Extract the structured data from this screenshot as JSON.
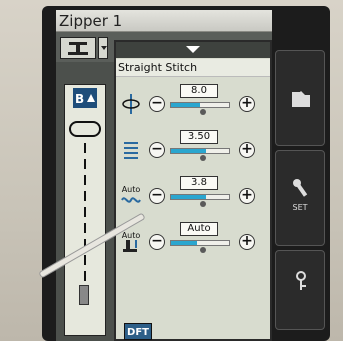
{
  "window": {
    "title": "Zipper 1"
  },
  "panel": {
    "stitch_name": "Straight Stitch",
    "default_button": "DFT"
  },
  "settings": [
    {
      "icon": "stitch-width-icon",
      "value": "8.0",
      "fill": 0.5,
      "knob": 0.55
    },
    {
      "icon": "stitch-length-icon",
      "value": "3.50",
      "fill": 0.6,
      "knob": 0.55
    },
    {
      "icon": "thread-tension-icon",
      "auto_label": "Auto",
      "value": "3.8",
      "fill": 0.6,
      "knob": 0.55
    },
    {
      "icon": "presser-foot-pressure-icon",
      "auto_label": "Auto",
      "value": "Auto",
      "fill": 0.45,
      "knob": 0.55
    }
  ],
  "side_buttons": {
    "set_label": "SET"
  },
  "colors": {
    "slider_fill": "#2aa6cf",
    "dft_button": "#2d5f88",
    "preview_icon": "#1e4d7a"
  }
}
